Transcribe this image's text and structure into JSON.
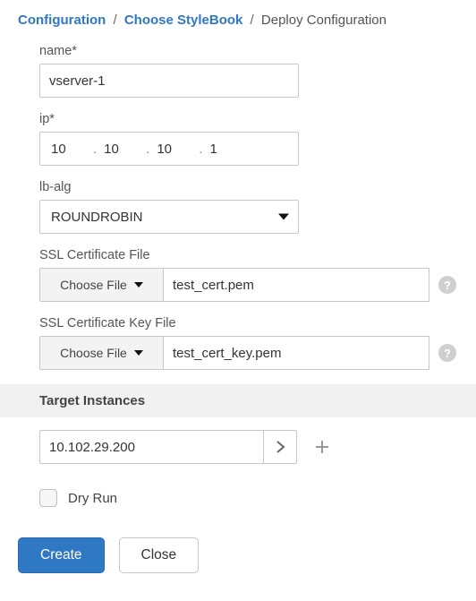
{
  "breadcrumb": {
    "configuration": "Configuration",
    "choose_stylebook": "Choose StyleBook",
    "deploy": "Deploy Configuration"
  },
  "fields": {
    "name_label": "name*",
    "name_value": "vserver-1",
    "ip_label": "ip*",
    "ip_o1": "10",
    "ip_o2": "10",
    "ip_o3": "10",
    "ip_o4": "1",
    "lbalg_label": "lb-alg",
    "lbalg_value": "ROUNDROBIN",
    "sslcert_label": "SSL Certificate File",
    "sslcert_value": "test_cert.pem",
    "sslcertkey_label": "SSL Certificate Key File",
    "sslcertkey_value": "test_cert_key.pem",
    "choose_file_label": "Choose File"
  },
  "target_instances": {
    "header": "Target Instances",
    "value": "10.102.29.200"
  },
  "dryrun_label": "Dry Run",
  "buttons": {
    "create": "Create",
    "close": "Close"
  },
  "icons": {
    "help": "?"
  }
}
